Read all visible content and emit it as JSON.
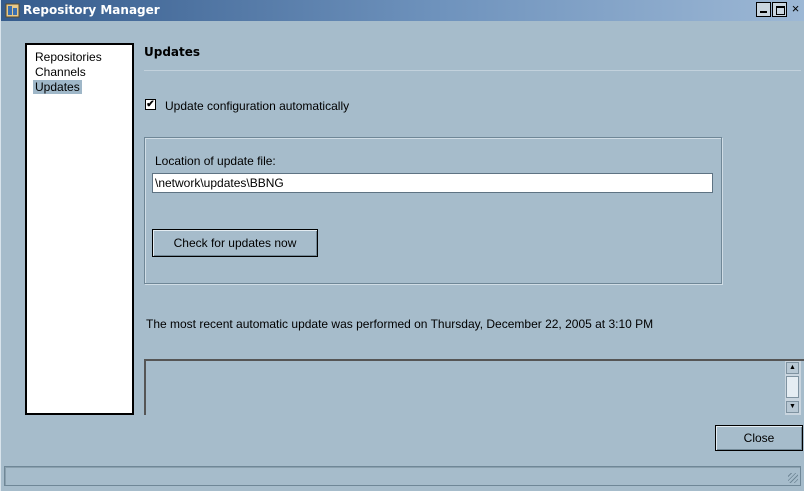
{
  "window": {
    "title": "Repository Manager",
    "accent": "#355b8c",
    "background": "#a6bccb"
  },
  "titlebar_buttons": {
    "minimize": "_",
    "maximize": "□",
    "close": "×"
  },
  "sidebar": {
    "items": [
      {
        "label": "Repositories",
        "selected": false
      },
      {
        "label": "Channels",
        "selected": false
      },
      {
        "label": "Updates",
        "selected": true
      }
    ]
  },
  "page": {
    "title": "Updates"
  },
  "auto_update": {
    "checked": true,
    "label": "Update configuration automatically"
  },
  "location": {
    "label": "Location of update file:",
    "value": "\\network\\updates\\BBNG"
  },
  "check_button": {
    "label": "Check for updates now"
  },
  "status": {
    "text": "The most recent automatic update was performed on Thursday, December 22, 2005 at 3:10 PM"
  },
  "footer": {
    "close_label": "Close",
    "status_text": ""
  }
}
